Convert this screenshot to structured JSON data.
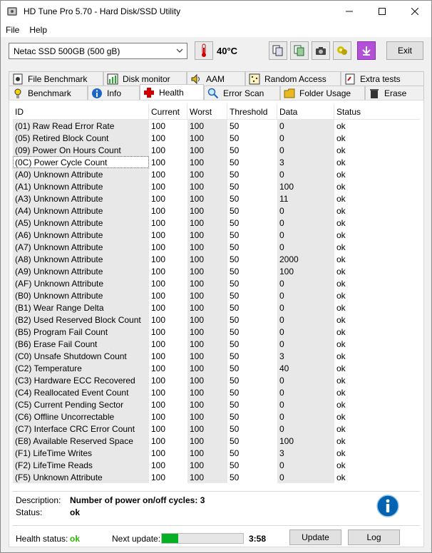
{
  "window": {
    "title": "HD Tune Pro 5.70 - Hard Disk/SSD Utility"
  },
  "menu": [
    {
      "label": "File"
    },
    {
      "label": "Help"
    }
  ],
  "toolbar": {
    "drive": "Netac SSD 500GB (500 gB)",
    "temperature": "40°C",
    "exit_label": "Exit"
  },
  "tabs_row1": [
    {
      "label": "File Benchmark",
      "icon": "file-benchmark-icon"
    },
    {
      "label": "Disk monitor",
      "icon": "disk-monitor-icon"
    },
    {
      "label": "AAM",
      "icon": "speaker-icon"
    },
    {
      "label": "Random Access",
      "icon": "random-access-icon"
    },
    {
      "label": "Extra tests",
      "icon": "extra-tests-icon"
    }
  ],
  "tabs_row2": [
    {
      "label": "Benchmark",
      "icon": "benchmark-icon"
    },
    {
      "label": "Info",
      "icon": "info-icon"
    },
    {
      "label": "Health",
      "icon": "health-cross-icon"
    },
    {
      "label": "Error Scan",
      "icon": "magnifier-icon"
    },
    {
      "label": "Folder Usage",
      "icon": "folder-icon"
    },
    {
      "label": "Erase",
      "icon": "trash-icon"
    }
  ],
  "table": {
    "headers": [
      "ID",
      "Current",
      "Worst",
      "Threshold",
      "Data",
      "Status"
    ],
    "rows": [
      [
        "(01) Raw Read Error Rate",
        "100",
        "100",
        "50",
        "0",
        "ok"
      ],
      [
        "(05) Retired Block Count",
        "100",
        "100",
        "50",
        "0",
        "ok"
      ],
      [
        "(09) Power On Hours Count",
        "100",
        "100",
        "50",
        "0",
        "ok"
      ],
      [
        "(0C) Power Cycle Count",
        "100",
        "100",
        "50",
        "3",
        "ok"
      ],
      [
        "(A0) Unknown Attribute",
        "100",
        "100",
        "50",
        "0",
        "ok"
      ],
      [
        "(A1) Unknown Attribute",
        "100",
        "100",
        "50",
        "100",
        "ok"
      ],
      [
        "(A3) Unknown Attribute",
        "100",
        "100",
        "50",
        "11",
        "ok"
      ],
      [
        "(A4) Unknown Attribute",
        "100",
        "100",
        "50",
        "0",
        "ok"
      ],
      [
        "(A5) Unknown Attribute",
        "100",
        "100",
        "50",
        "0",
        "ok"
      ],
      [
        "(A6) Unknown Attribute",
        "100",
        "100",
        "50",
        "0",
        "ok"
      ],
      [
        "(A7) Unknown Attribute",
        "100",
        "100",
        "50",
        "0",
        "ok"
      ],
      [
        "(A8) Unknown Attribute",
        "100",
        "100",
        "50",
        "2000",
        "ok"
      ],
      [
        "(A9) Unknown Attribute",
        "100",
        "100",
        "50",
        "100",
        "ok"
      ],
      [
        "(AF) Unknown Attribute",
        "100",
        "100",
        "50",
        "0",
        "ok"
      ],
      [
        "(B0) Unknown Attribute",
        "100",
        "100",
        "50",
        "0",
        "ok"
      ],
      [
        "(B1) Wear Range Delta",
        "100",
        "100",
        "50",
        "0",
        "ok"
      ],
      [
        "(B2) Used Reserved Block Count",
        "100",
        "100",
        "50",
        "0",
        "ok"
      ],
      [
        "(B5) Program Fail Count",
        "100",
        "100",
        "50",
        "0",
        "ok"
      ],
      [
        "(B6) Erase Fail Count",
        "100",
        "100",
        "50",
        "0",
        "ok"
      ],
      [
        "(C0) Unsafe Shutdown Count",
        "100",
        "100",
        "50",
        "3",
        "ok"
      ],
      [
        "(C2) Temperature",
        "100",
        "100",
        "50",
        "40",
        "ok"
      ],
      [
        "(C3) Hardware ECC Recovered",
        "100",
        "100",
        "50",
        "0",
        "ok"
      ],
      [
        "(C4) Reallocated Event Count",
        "100",
        "100",
        "50",
        "0",
        "ok"
      ],
      [
        "(C5) Current Pending Sector",
        "100",
        "100",
        "50",
        "0",
        "ok"
      ],
      [
        "(C6) Offline Uncorrectable",
        "100",
        "100",
        "50",
        "0",
        "ok"
      ],
      [
        "(C7) Interface CRC Error Count",
        "100",
        "100",
        "50",
        "0",
        "ok"
      ],
      [
        "(E8) Available Reserved Space",
        "100",
        "100",
        "50",
        "100",
        "ok"
      ],
      [
        "(F1) LifeTime Writes",
        "100",
        "100",
        "50",
        "3",
        "ok"
      ],
      [
        "(F2) LifeTime Reads",
        "100",
        "100",
        "50",
        "0",
        "ok"
      ],
      [
        "(F5) Unknown Attribute",
        "100",
        "100",
        "50",
        "0",
        "ok"
      ]
    ],
    "selected_row": 3
  },
  "details": {
    "description_label": "Description:",
    "description": "Number of power on/off cycles: 3",
    "status_label": "Status:",
    "status": "ok"
  },
  "footer": {
    "health_label": "Health status:",
    "health_value": "ok",
    "next_update_label": "Next update:",
    "progress_fraction": 0.2,
    "timer": "3:58",
    "update_label": "Update",
    "log_label": "Log"
  },
  "colors": {
    "ok_green": "#2db400",
    "progress_green": "#06b025",
    "accent_blue": "#0063b1"
  }
}
